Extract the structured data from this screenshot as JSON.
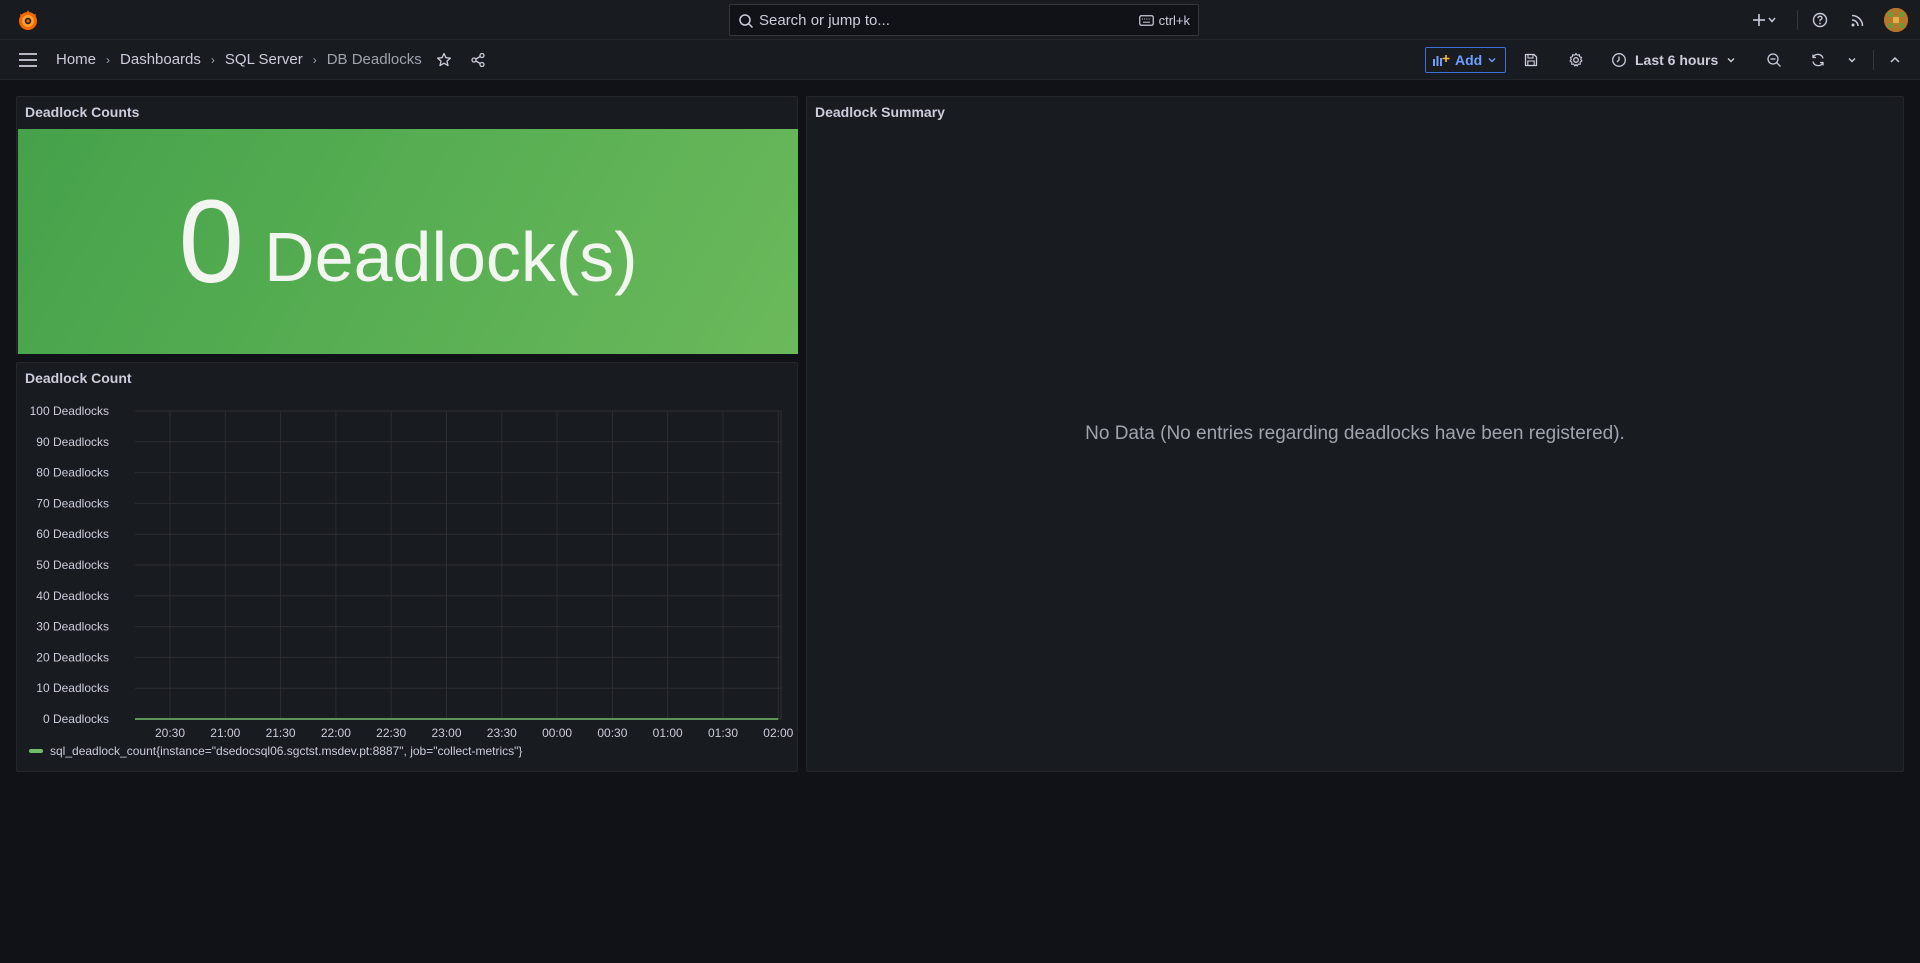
{
  "search": {
    "placeholder": "Search or jump to...",
    "shortcut": "ctrl+k"
  },
  "breadcrumb": {
    "home": "Home",
    "dashboards": "Dashboards",
    "folder": "SQL Server",
    "current": "DB Deadlocks"
  },
  "toolbar": {
    "add_label": "Add",
    "time_range": "Last 6 hours"
  },
  "panels": {
    "counts": {
      "title": "Deadlock Counts",
      "value": "0",
      "unit": "Deadlock(s)",
      "color": "#56ad52"
    },
    "count_chart": {
      "title": "Deadlock Count"
    },
    "summary": {
      "title": "Deadlock Summary",
      "no_data": "No Data (No entries regarding deadlocks have been registered)."
    }
  },
  "chart_data": {
    "type": "line",
    "title": "Deadlock Count",
    "x": [
      "20:30",
      "21:00",
      "21:30",
      "22:00",
      "22:30",
      "23:00",
      "23:30",
      "00:00",
      "00:30",
      "01:00",
      "01:30",
      "02:00"
    ],
    "y_ticks": [
      "100 Deadlocks",
      "90 Deadlocks",
      "80 Deadlocks",
      "70 Deadlocks",
      "60 Deadlocks",
      "50 Deadlocks",
      "40 Deadlocks",
      "30 Deadlocks",
      "20 Deadlocks",
      "10 Deadlocks",
      "0 Deadlocks"
    ],
    "ylim": [
      0,
      100
    ],
    "series": [
      {
        "name": "sql_deadlock_count{instance=\"dsedocsql06.sgctst.msdev.pt:8887\", job=\"collect-metrics\"}",
        "values": [
          0,
          0,
          0,
          0,
          0,
          0,
          0,
          0,
          0,
          0,
          0,
          0
        ],
        "color": "#73bf69"
      }
    ],
    "grid": true,
    "legend": "bottom-left"
  }
}
